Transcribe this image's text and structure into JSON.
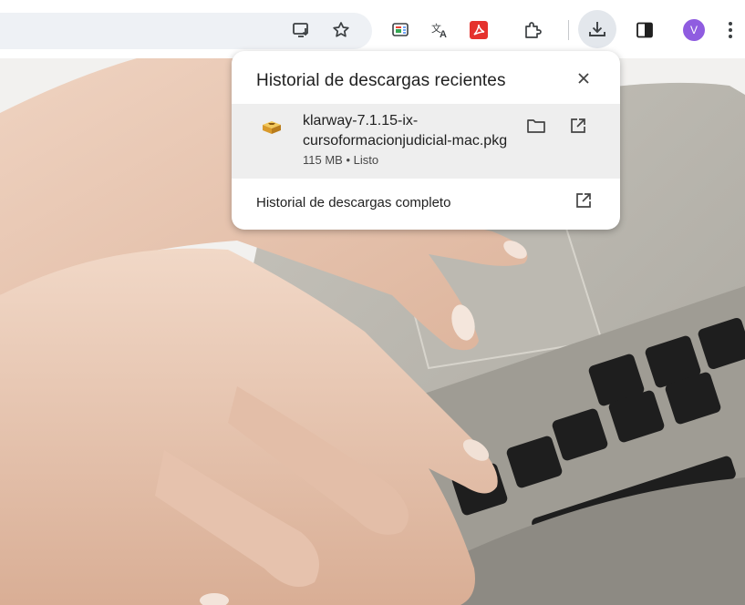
{
  "toolbar": {
    "icons": [
      "cast-install-icon",
      "bookmark-star-icon",
      "reading-mode-icon",
      "translate-icon",
      "pdf-extension-icon",
      "extensions-puzzle-icon",
      "download-icon",
      "side-panel-icon",
      "avatar",
      "more-menu-icon"
    ],
    "avatar_letter": "V",
    "avatar_color": "#8f5ce0"
  },
  "downloads": {
    "title": "Historial de descargas recientes",
    "items": [
      {
        "filename_line1": "klarway-7.1.15-ix-",
        "filename_line2": "cursoformacionjudicial-mac.pkg",
        "status": "115 MB • Listo",
        "icon": "package-icon"
      }
    ],
    "full_history_label": "Historial de descargas completo"
  }
}
